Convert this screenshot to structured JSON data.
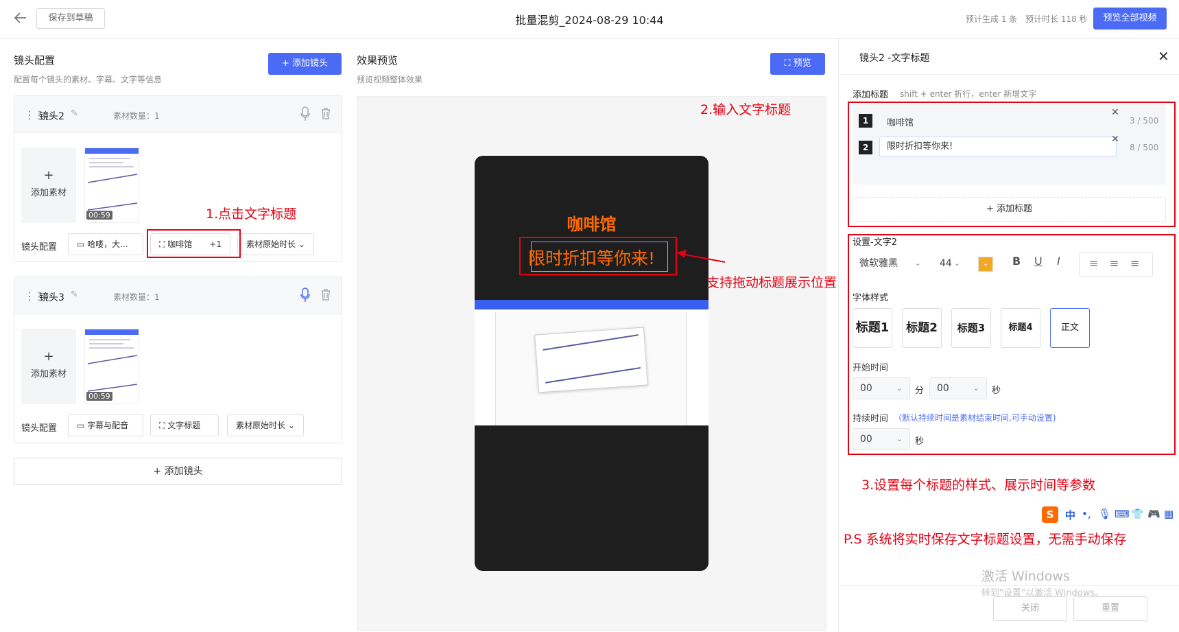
{
  "header": {
    "back_icon": "arrow-left-icon",
    "save_draft": "保存到草稿",
    "title": "批量混剪_2024-08-29 10:44",
    "estimate_count": "预计生成 1 条",
    "estimate_duration": "预计时长 118 秒",
    "preview_all": "预览全部视频"
  },
  "left": {
    "title": "镜头配置",
    "subtitle": "配置每个镜头的素材、字幕、文字等信息",
    "add_shot": "+  添加镜头",
    "shots": [
      {
        "name": "镜头2",
        "count": "素材数量：1",
        "add_material": "添加素材",
        "plus": "+",
        "time": "00:59",
        "config_label": "镜头配置",
        "chip1": "哈喽，大...",
        "chip2": "咖啡馆",
        "chip2_extra": "+1",
        "chip3": "素材原始时长"
      },
      {
        "name": "镜头3",
        "count": "素材数量：1",
        "add_material": "添加素材",
        "plus": "+",
        "time": "00:59",
        "config_label": "镜头配置",
        "chip1": "字幕与配音",
        "chip2": "文字标题",
        "chip3": "素材原始时长"
      }
    ],
    "add_shot_bottom": "+ 添加镜头"
  },
  "middle": {
    "title": "效果预览",
    "subtitle": "预览视频整体效果",
    "preview_btn": "预览",
    "phone_title": "咖啡馆",
    "phone_subtitle": "限时折扣等你来!"
  },
  "annotations": {
    "step1": "1.点击文字标题",
    "step2": "2.输入文字标题",
    "drag_note": "支持拖动标题展示位置",
    "step3": "3.设置每个标题的样式、展示时间等参数",
    "ps": "P.S 系统将实时保存文字标题设置，无需手动保存",
    "accent": "#e60012"
  },
  "right": {
    "title": "镜头2 -文字标题",
    "add_title_label": "添加标题",
    "add_title_hint": "shift + enter 折行，enter 新增文字",
    "titles": [
      {
        "index": "1",
        "text": "咖啡馆",
        "counter": "3 / 500"
      },
      {
        "index": "2",
        "text": "限时折扣等你来!",
        "counter": "8 / 500"
      }
    ],
    "add_title_btn": "+ 添加标题",
    "settings_label": "设置-文字2",
    "font": "微软雅黑",
    "font_size": "44",
    "color": "#f5a623",
    "bold": "B",
    "underline": "U",
    "italic": "I",
    "font_style_label": "字体样式",
    "styles": [
      "标题1",
      "标题2",
      "标题3",
      "标题4",
      "正文"
    ],
    "start_time_label": "开始时间",
    "start_min": "00",
    "min_unit": "分",
    "start_sec": "00",
    "sec_unit": "秒",
    "duration_label": "持续时间",
    "duration_hint": "（默认持续时间是素材结束时间,可手动设置)",
    "duration_sec": "00",
    "close_btn": "关闭",
    "reset_btn": "重置",
    "watermark1": "激活 Windows",
    "watermark2": "转到\"设置\"以激活 Windows。"
  },
  "ime": {
    "lang": "中"
  }
}
